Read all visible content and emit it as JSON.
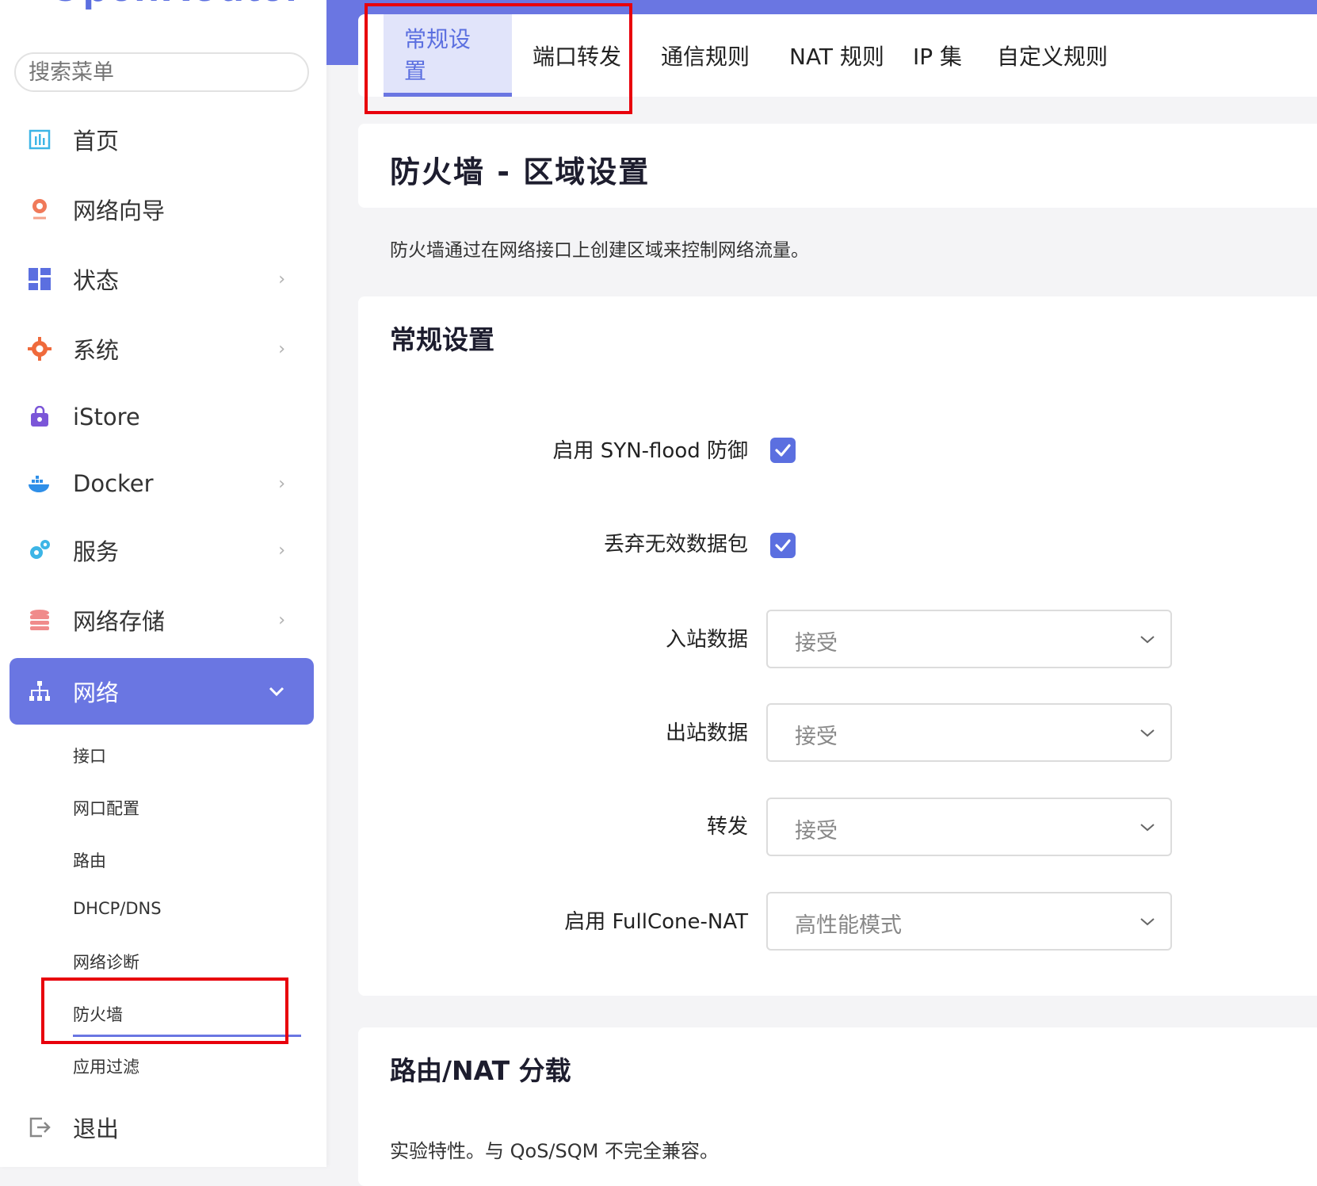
{
  "brand": "OpenRouter",
  "search": {
    "placeholder": "搜索菜单"
  },
  "sidebar": {
    "items": [
      {
        "label": "首页",
        "icon": "dashboard-chart-icon",
        "chevron": ""
      },
      {
        "label": "网络向导",
        "icon": "globe-pin-icon",
        "chevron": ""
      },
      {
        "label": "状态",
        "icon": "grid-icon",
        "chevron": "›"
      },
      {
        "label": "系统",
        "icon": "gear-icon",
        "chevron": "›"
      },
      {
        "label": "iStore",
        "icon": "shopping-bag-icon",
        "chevron": ""
      },
      {
        "label": "Docker",
        "icon": "docker-whale-icon",
        "chevron": "›"
      },
      {
        "label": "服务",
        "icon": "gears-icon",
        "chevron": "›"
      },
      {
        "label": "网络存储",
        "icon": "database-icon",
        "chevron": "›"
      },
      {
        "label": "网络",
        "icon": "network-tree-icon",
        "chevron": "⌄"
      }
    ],
    "sub_items": [
      "接口",
      "网口配置",
      "路由",
      "DHCP/DNS",
      "网络诊断",
      "防火墙",
      "应用过滤"
    ],
    "logout": {
      "label": "退出",
      "icon": "logout-icon"
    }
  },
  "tabs": [
    "常规设置",
    "端口转发",
    "通信规则",
    "NAT 规则",
    "IP 集",
    "自定义规则"
  ],
  "page": {
    "title": "防火墙 - 区域设置",
    "description": "防火墙通过在网络接口上创建区域来控制网络流量。"
  },
  "general": {
    "title": "常规设置",
    "syn_flood_label": "启用 SYN-flood 防御",
    "drop_invalid_label": "丢弃无效数据包",
    "input_label": "入站数据",
    "input_value": "接受",
    "output_label": "出站数据",
    "output_value": "接受",
    "forward_label": "转发",
    "forward_value": "接受",
    "fullcone_label": "启用 FullCone-NAT",
    "fullcone_value": "高性能模式"
  },
  "offload": {
    "title": "路由/NAT 分载",
    "note": "实验特性。与 QoS/SQM 不完全兼容。"
  },
  "colors": {
    "accent": "#6a76e2",
    "highlight_box": "#e8000c"
  }
}
